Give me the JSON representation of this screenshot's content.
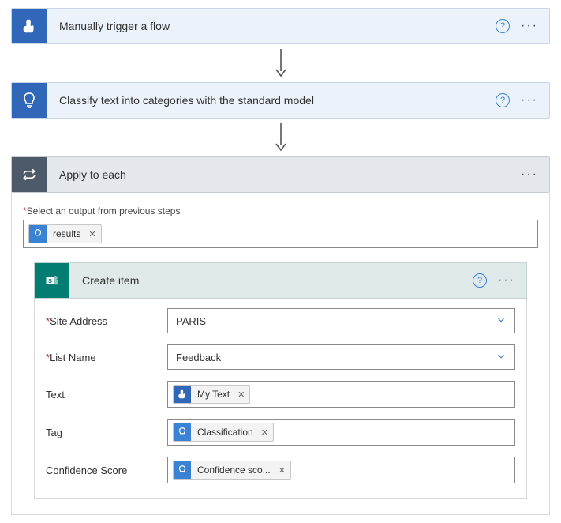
{
  "steps": {
    "trigger": {
      "title": "Manually trigger a flow"
    },
    "classify": {
      "title": "Classify text into categories with the standard model"
    },
    "apply": {
      "title": "Apply to each"
    },
    "create": {
      "title": "Create item"
    }
  },
  "apply_panel": {
    "output_label": "Select an output from previous steps",
    "output_token": "results"
  },
  "create_item": {
    "fields": {
      "site_address": {
        "label": "Site Address",
        "value": "PARIS"
      },
      "list_name": {
        "label": "List Name",
        "value": "Feedback"
      },
      "text": {
        "label": "Text",
        "token": "My Text"
      },
      "tag": {
        "label": "Tag",
        "token": "Classification"
      },
      "confidence": {
        "label": "Confidence Score",
        "token": "Confidence sco..."
      }
    }
  }
}
